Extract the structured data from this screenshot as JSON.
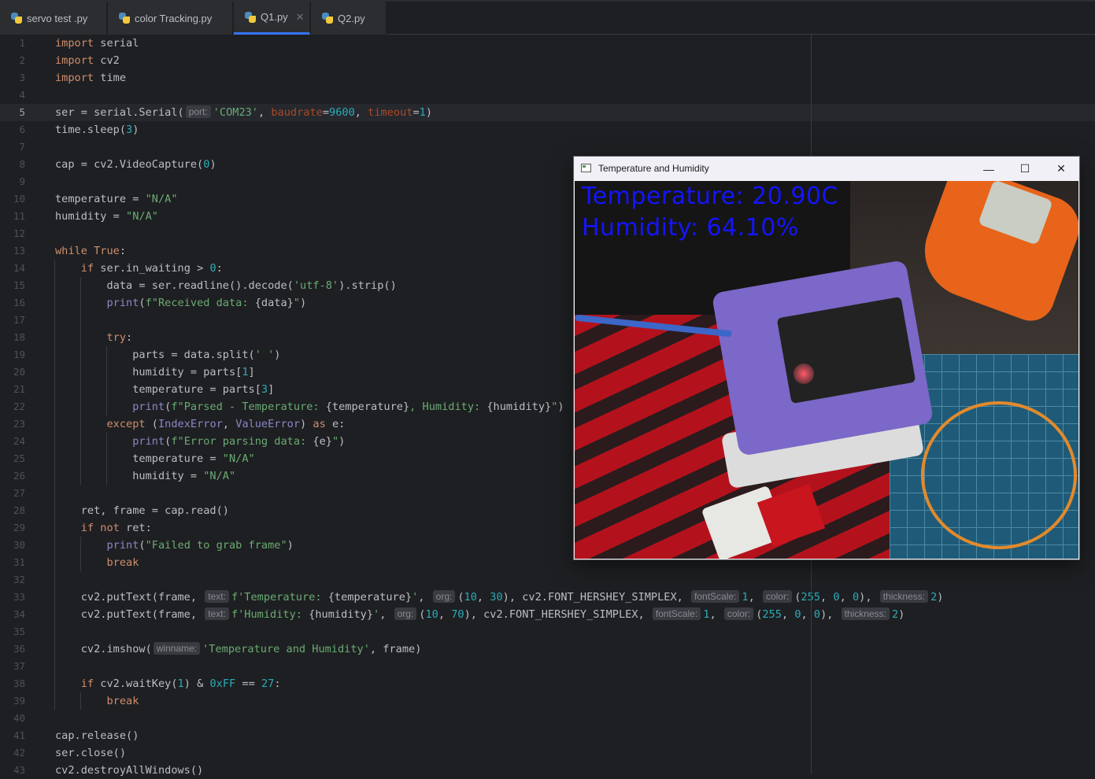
{
  "tabs": [
    {
      "label": "servo test .py"
    },
    {
      "label": "color Tracking.py"
    },
    {
      "label": "Q1.py",
      "active": true
    },
    {
      "label": "Q2.py"
    }
  ],
  "current_line": 5,
  "lines": [
    [
      [
        "kw",
        "import"
      ],
      [
        "tx",
        " serial"
      ]
    ],
    [
      [
        "kw",
        "import"
      ],
      [
        "tx",
        " cv2"
      ]
    ],
    [
      [
        "kw",
        "import"
      ],
      [
        "tx",
        " time"
      ]
    ],
    [],
    [
      [
        "tx",
        "ser = serial.Serial("
      ],
      [
        "hint",
        "port:"
      ],
      [
        "st",
        "'COM23'"
      ],
      [
        "tx",
        ", "
      ],
      [
        "pa",
        "baudrate"
      ],
      [
        "tx",
        "="
      ],
      [
        "nu",
        "9600"
      ],
      [
        "tx",
        ", "
      ],
      [
        "pa",
        "timeout"
      ],
      [
        "tx",
        "="
      ],
      [
        "nu",
        "1"
      ],
      [
        "tx",
        ")"
      ]
    ],
    [
      [
        "tx",
        "time.sleep("
      ],
      [
        "nu",
        "3"
      ],
      [
        "tx",
        ")"
      ]
    ],
    [],
    [
      [
        "tx",
        "cap = cv2.VideoCapture("
      ],
      [
        "nu",
        "0"
      ],
      [
        "tx",
        ")"
      ]
    ],
    [],
    [
      [
        "tx",
        "temperature = "
      ],
      [
        "st",
        "\"N/A\""
      ]
    ],
    [
      [
        "tx",
        "humidity = "
      ],
      [
        "st",
        "\"N/A\""
      ]
    ],
    [],
    [
      [
        "kw",
        "while"
      ],
      [
        "tx",
        " "
      ],
      [
        "kw",
        "True"
      ],
      [
        "tx",
        ":"
      ]
    ],
    [
      [
        "tx",
        "    "
      ],
      [
        "kw",
        "if"
      ],
      [
        "tx",
        " ser.in_waiting > "
      ],
      [
        "nu",
        "0"
      ],
      [
        "tx",
        ":"
      ]
    ],
    [
      [
        "tx",
        "        data = ser.readline().decode("
      ],
      [
        "st",
        "'utf-8'"
      ],
      [
        "tx",
        ").strip()"
      ]
    ],
    [
      [
        "tx",
        "        "
      ],
      [
        "bi",
        "print"
      ],
      [
        "tx",
        "("
      ],
      [
        "st",
        "f\"Received data: "
      ],
      [
        "tx",
        "{data}"
      ],
      [
        "st",
        "\""
      ],
      [
        "tx",
        ")"
      ]
    ],
    [],
    [
      [
        "tx",
        "        "
      ],
      [
        "kw",
        "try"
      ],
      [
        "tx",
        ":"
      ]
    ],
    [
      [
        "tx",
        "            parts = data.split("
      ],
      [
        "st",
        "' '"
      ],
      [
        "tx",
        ")"
      ]
    ],
    [
      [
        "tx",
        "            humidity = parts["
      ],
      [
        "nu",
        "1"
      ],
      [
        "tx",
        "]"
      ]
    ],
    [
      [
        "tx",
        "            temperature = parts["
      ],
      [
        "nu",
        "3"
      ],
      [
        "tx",
        "]"
      ]
    ],
    [
      [
        "tx",
        "            "
      ],
      [
        "bi",
        "print"
      ],
      [
        "tx",
        "("
      ],
      [
        "st",
        "f\"Parsed - Temperature: "
      ],
      [
        "tx",
        "{temperature}"
      ],
      [
        "st",
        ", Humidity: "
      ],
      [
        "tx",
        "{humidity}"
      ],
      [
        "st",
        "\""
      ],
      [
        "tx",
        ")"
      ]
    ],
    [
      [
        "tx",
        "        "
      ],
      [
        "kw",
        "except"
      ],
      [
        "tx",
        " ("
      ],
      [
        "bi",
        "IndexError"
      ],
      [
        "tx",
        ", "
      ],
      [
        "bi",
        "ValueError"
      ],
      [
        "tx",
        ") "
      ],
      [
        "kw",
        "as"
      ],
      [
        "tx",
        " e:"
      ]
    ],
    [
      [
        "tx",
        "            "
      ],
      [
        "bi",
        "print"
      ],
      [
        "tx",
        "("
      ],
      [
        "st",
        "f\"Error parsing data: "
      ],
      [
        "tx",
        "{e}"
      ],
      [
        "st",
        "\""
      ],
      [
        "tx",
        ")"
      ]
    ],
    [
      [
        "tx",
        "            temperature = "
      ],
      [
        "st",
        "\"N/A\""
      ]
    ],
    [
      [
        "tx",
        "            humidity = "
      ],
      [
        "st",
        "\"N/A\""
      ]
    ],
    [],
    [
      [
        "tx",
        "    ret, frame = cap.read()"
      ]
    ],
    [
      [
        "tx",
        "    "
      ],
      [
        "kw",
        "if not"
      ],
      [
        "tx",
        " ret:"
      ]
    ],
    [
      [
        "tx",
        "        "
      ],
      [
        "bi",
        "print"
      ],
      [
        "tx",
        "("
      ],
      [
        "st",
        "\"Failed to grab frame\""
      ],
      [
        "tx",
        ")"
      ]
    ],
    [
      [
        "tx",
        "        "
      ],
      [
        "kw",
        "break"
      ]
    ],
    [],
    [
      [
        "tx",
        "    cv2.putText(frame, "
      ],
      [
        "hint",
        "text:"
      ],
      [
        "st",
        "f'Temperature: "
      ],
      [
        "tx",
        "{temperature}"
      ],
      [
        "st",
        "'"
      ],
      [
        "tx",
        ", "
      ],
      [
        "hint",
        "org:"
      ],
      [
        "tx",
        "("
      ],
      [
        "nu",
        "10"
      ],
      [
        "tx",
        ", "
      ],
      [
        "nu",
        "30"
      ],
      [
        "tx",
        "), cv2.FONT_HERSHEY_SIMPLEX, "
      ],
      [
        "hint",
        "fontScale:"
      ],
      [
        "nu",
        "1"
      ],
      [
        "tx",
        ", "
      ],
      [
        "hint",
        "color:"
      ],
      [
        "tx",
        "("
      ],
      [
        "nu",
        "255"
      ],
      [
        "tx",
        ", "
      ],
      [
        "nu",
        "0"
      ],
      [
        "tx",
        ", "
      ],
      [
        "nu",
        "0"
      ],
      [
        "tx",
        "), "
      ],
      [
        "hint",
        "thickness:"
      ],
      [
        "nu",
        "2"
      ],
      [
        "tx",
        ")"
      ]
    ],
    [
      [
        "tx",
        "    cv2.putText(frame, "
      ],
      [
        "hint",
        "text:"
      ],
      [
        "st",
        "f'Humidity: "
      ],
      [
        "tx",
        "{humidity}"
      ],
      [
        "st",
        "'"
      ],
      [
        "tx",
        ", "
      ],
      [
        "hint",
        "org:"
      ],
      [
        "tx",
        "("
      ],
      [
        "nu",
        "10"
      ],
      [
        "tx",
        ", "
      ],
      [
        "nu",
        "70"
      ],
      [
        "tx",
        "), cv2.FONT_HERSHEY_SIMPLEX, "
      ],
      [
        "hint",
        "fontScale:"
      ],
      [
        "nu",
        "1"
      ],
      [
        "tx",
        ", "
      ],
      [
        "hint",
        "color:"
      ],
      [
        "tx",
        "("
      ],
      [
        "nu",
        "255"
      ],
      [
        "tx",
        ", "
      ],
      [
        "nu",
        "0"
      ],
      [
        "tx",
        ", "
      ],
      [
        "nu",
        "0"
      ],
      [
        "tx",
        "), "
      ],
      [
        "hint",
        "thickness:"
      ],
      [
        "nu",
        "2"
      ],
      [
        "tx",
        ")"
      ]
    ],
    [],
    [
      [
        "tx",
        "    cv2.imshow("
      ],
      [
        "hint",
        "winname:"
      ],
      [
        "st",
        "'Temperature and Humidity'"
      ],
      [
        "tx",
        ", frame)"
      ]
    ],
    [],
    [
      [
        "tx",
        "    "
      ],
      [
        "kw",
        "if"
      ],
      [
        "tx",
        " cv2.waitKey("
      ],
      [
        "nu",
        "1"
      ],
      [
        "tx",
        ") & "
      ],
      [
        "nu",
        "0xFF"
      ],
      [
        "tx",
        " == "
      ],
      [
        "nu",
        "27"
      ],
      [
        "tx",
        ":"
      ]
    ],
    [
      [
        "tx",
        "        "
      ],
      [
        "kw",
        "break"
      ]
    ],
    [],
    [
      [
        "tx",
        "cap.release()"
      ]
    ],
    [
      [
        "tx",
        "ser.close()"
      ]
    ],
    [
      [
        "tx",
        "cv2.destroyAllWindows()"
      ]
    ]
  ],
  "window": {
    "title": "Temperature and Humidity",
    "minimize_glyph": "—",
    "maximize_glyph": "☐",
    "close_glyph": "✕",
    "overlay_temperature": "Temperature: 20.90C",
    "overlay_humidity": "Humidity: 64.10%"
  },
  "colors": {
    "keyword": "#cf8e6d",
    "string": "#6aab73",
    "number": "#2aacb8",
    "builtin": "#8888c6",
    "param": "#aa4926",
    "overlay_text": "#1414ff"
  }
}
